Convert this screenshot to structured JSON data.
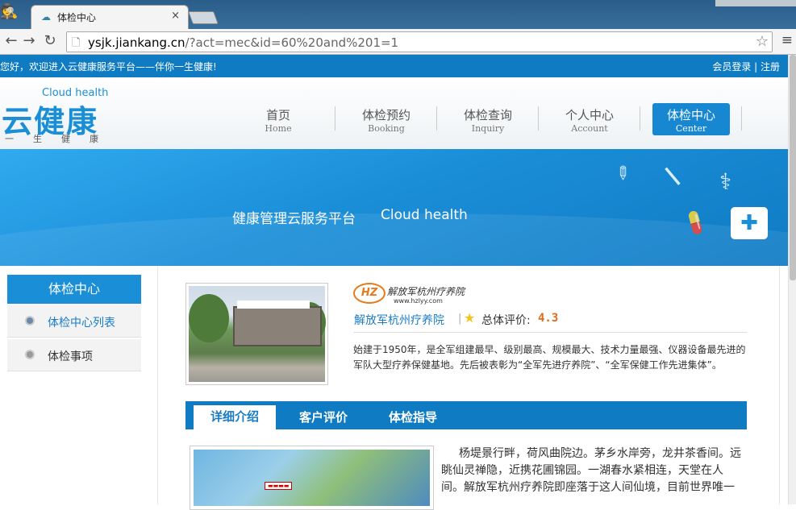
{
  "browser": {
    "tab_title": "体检中心",
    "tab_close": "×",
    "url_host": "ysjk.jiankang.cn",
    "url_path": "/?act=mec&id=60%20and%201=1"
  },
  "topbar": {
    "welcome": "您好，欢迎进入云健康服务平台——伴你一生健康!",
    "account": "会员登录 | 注册"
  },
  "logo": {
    "cloud": "Cloud health",
    "main": "云健康",
    "sub": "一生健康"
  },
  "nav": [
    {
      "cn": "首页",
      "en": "Home"
    },
    {
      "cn": "体检预约",
      "en": "Booking"
    },
    {
      "cn": "体检查询",
      "en": "Inquiry"
    },
    {
      "cn": "个人中心",
      "en": "Account"
    },
    {
      "cn": "体检中心",
      "en": "Center"
    }
  ],
  "banner": {
    "title": "健康管理云服务平台",
    "subtitle": "Cloud health"
  },
  "sidebar": {
    "heading": "体检中心",
    "items": [
      {
        "label": "体检中心列表"
      },
      {
        "label": "体检事项"
      }
    ]
  },
  "hospital": {
    "logo_text": "解放军杭州疗养院",
    "logo_url": "www.hzlyy.com",
    "name": "解放军杭州疗养院",
    "rating_label": "总体评价:",
    "rating_value": "4.3",
    "description": "始建于1950年，是全军组建最早、级别最高、规模最大、技术力量最强、仪器设备最先进的军队大型疗养保健基地。先后被表彰为“全军先进疗养院”、“全军保健工作先进集体”。"
  },
  "tabs": [
    {
      "label": "详细介绍"
    },
    {
      "label": "客户评价"
    },
    {
      "label": "体检指导"
    }
  ],
  "article": {
    "text": "杨堤景行畔，荷风曲院边。茅乡水岸旁，龙井茶香间。远眺仙灵禅隐，近携花圃锦园。一湖春水紧相连，天堂在人间。解放军杭州疗养院即座落于这人间仙境，目前世界唯一"
  }
}
